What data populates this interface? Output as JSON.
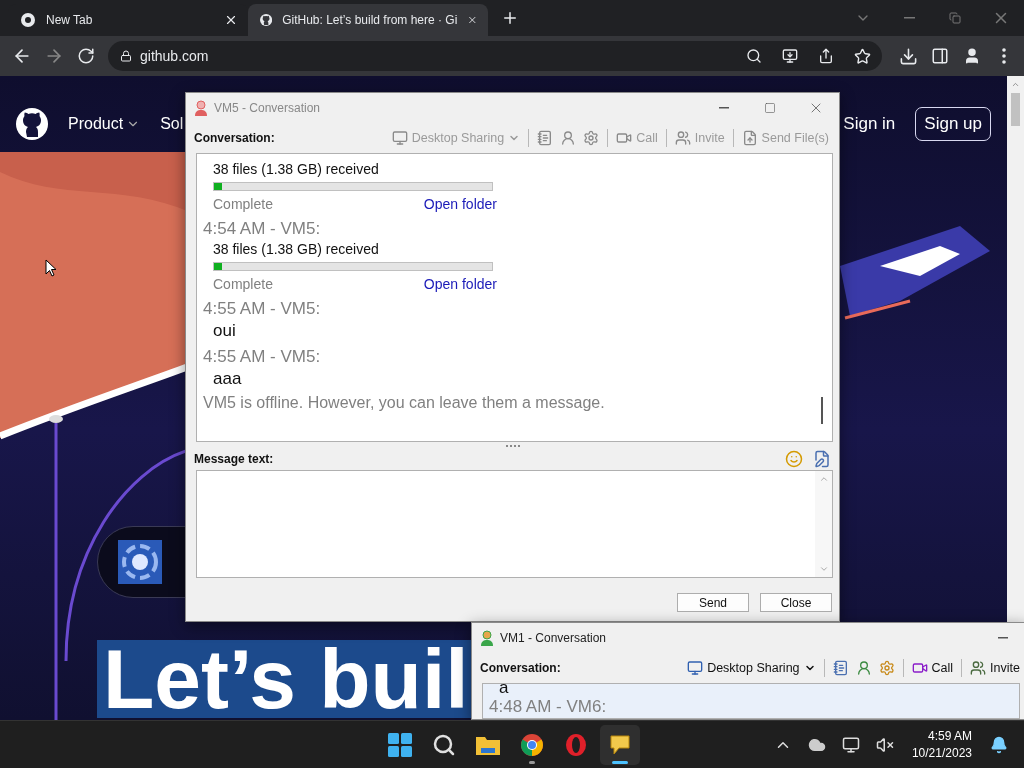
{
  "browser": {
    "tabs": [
      {
        "title": "New Tab",
        "selected": false
      },
      {
        "title": "GitHub: Let’s build from here · Gi",
        "selected": true
      }
    ],
    "address": "github.com",
    "page": {
      "nav": [
        "Product",
        "Sol"
      ],
      "sign_in": "Sign in",
      "sign_up": "Sign up",
      "headline": "Let’s buil"
    }
  },
  "windows": [
    {
      "title": "VM5 - Conversation",
      "online": false,
      "active": false,
      "conversation_label": "Conversation:",
      "toolbar": {
        "disabled": true,
        "items": [
          {
            "kind": "share",
            "label": "Desktop Sharing"
          },
          {
            "kind": "separator"
          },
          {
            "kind": "notes"
          },
          {
            "kind": "info"
          },
          {
            "kind": "settings"
          },
          {
            "kind": "separator"
          },
          {
            "kind": "call",
            "label": "Call"
          },
          {
            "kind": "separator"
          },
          {
            "kind": "invite",
            "label": "Invite"
          },
          {
            "kind": "separator"
          },
          {
            "kind": "send",
            "label": "Send File(s)"
          }
        ]
      },
      "entries": [
        {
          "kind": "transfer",
          "text": "38 files (1.38 GB) received",
          "level": 0.03,
          "status": "Complete",
          "link": "Open folder"
        },
        {
          "kind": "header",
          "text": "4:54 AM - VM5:"
        },
        {
          "kind": "transfer",
          "text": "38 files (1.38 GB) received",
          "level": 0.03,
          "status": "Complete",
          "link": "Open folder"
        },
        {
          "kind": "header",
          "text": "4:55 AM - VM5:"
        },
        {
          "kind": "text",
          "text": "oui"
        },
        {
          "kind": "header",
          "text": "4:55 AM - VM5:"
        },
        {
          "kind": "text",
          "text": "aaa"
        },
        {
          "kind": "notice",
          "text": "VM5 is offline. However, you can leave them a message."
        }
      ],
      "message_label": "Message text:",
      "buttons": [
        "Send",
        "Close"
      ]
    },
    {
      "title": "VM1 - Conversation",
      "online": true,
      "active": true,
      "conversation_label": "Conversation:",
      "toolbar": {
        "disabled": false,
        "items": [
          {
            "kind": "share",
            "label": "Desktop Sharing"
          },
          {
            "kind": "separator"
          },
          {
            "kind": "notes"
          },
          {
            "kind": "info"
          },
          {
            "kind": "settings"
          },
          {
            "kind": "separator"
          },
          {
            "kind": "call",
            "label": "Call"
          },
          {
            "kind": "separator"
          },
          {
            "kind": "invite",
            "label": "Invite"
          }
        ]
      },
      "entries": [
        {
          "kind": "text",
          "text": "a"
        },
        {
          "kind": "header",
          "text": "4:48 AM - VM6:"
        }
      ]
    }
  ],
  "taskbar": {
    "apps": [
      {
        "kind": "start",
        "selected": false,
        "running": false
      },
      {
        "kind": "search",
        "selected": false,
        "running": false
      },
      {
        "kind": "files",
        "selected": false,
        "running": false
      },
      {
        "kind": "chrome",
        "selected": false,
        "running": true
      },
      {
        "kind": "opera",
        "selected": false,
        "running": false
      },
      {
        "kind": "messenger",
        "selected": true,
        "running": true
      }
    ],
    "time": "4:59 AM",
    "date": "10/21/2023"
  }
}
